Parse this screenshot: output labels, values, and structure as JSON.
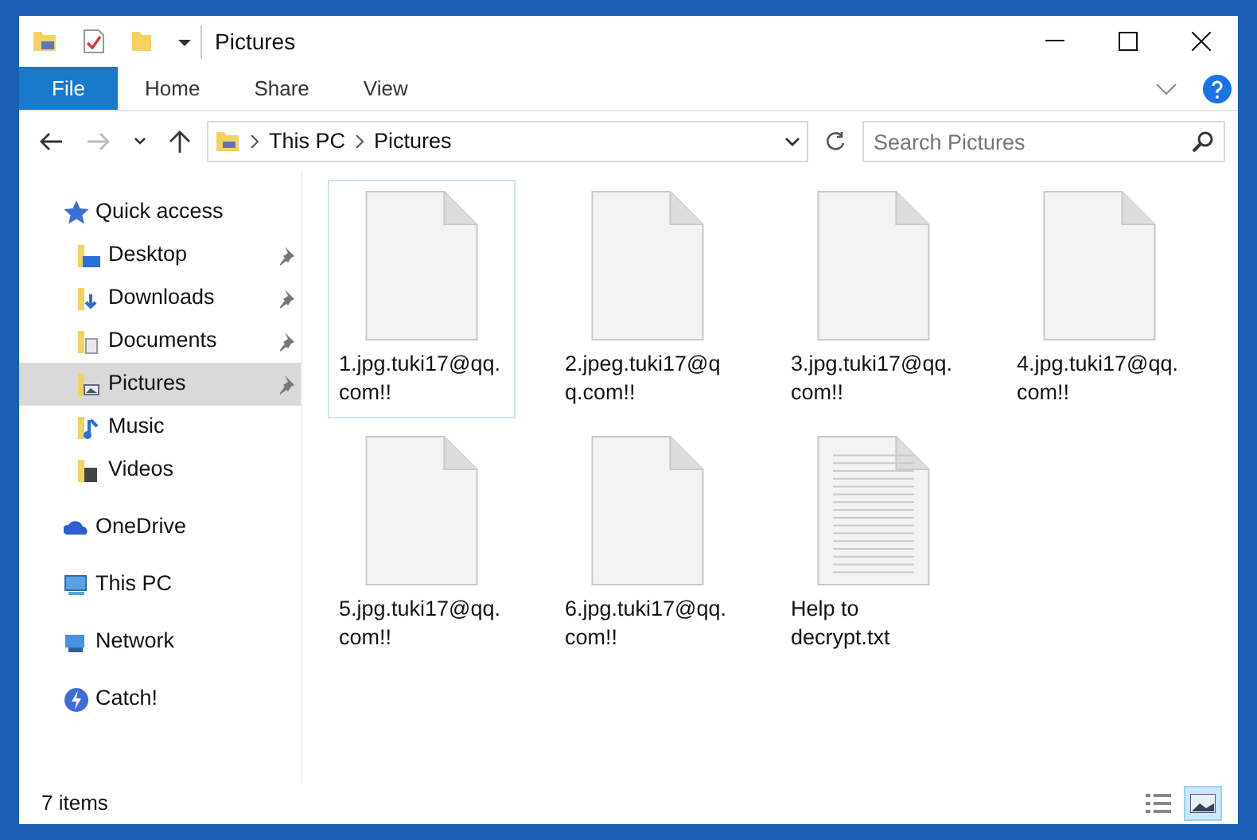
{
  "window": {
    "title": "Pictures"
  },
  "ribbon_tabs": [
    {
      "label": "File",
      "selected": true
    },
    {
      "label": "Home",
      "selected": false
    },
    {
      "label": "Share",
      "selected": false
    },
    {
      "label": "View",
      "selected": false
    }
  ],
  "address_bar": {
    "crumbs": [
      "This PC",
      "Pictures"
    ]
  },
  "search": {
    "placeholder": "Search Pictures"
  },
  "sidebar": {
    "items": [
      {
        "label": "Quick access",
        "kind": "star",
        "selected": false,
        "children": [
          {
            "label": "Desktop",
            "kind": "desktop",
            "pinned": true,
            "selected": false
          },
          {
            "label": "Downloads",
            "kind": "downloads",
            "pinned": true,
            "selected": false
          },
          {
            "label": "Documents",
            "kind": "documents",
            "pinned": true,
            "selected": false
          },
          {
            "label": "Pictures",
            "kind": "pictures",
            "pinned": true,
            "selected": true
          },
          {
            "label": "Music",
            "kind": "music",
            "pinned": false,
            "selected": false
          },
          {
            "label": "Videos",
            "kind": "videos",
            "pinned": false,
            "selected": false
          }
        ]
      },
      {
        "label": "OneDrive",
        "kind": "cloud",
        "selected": false
      },
      {
        "label": "This PC",
        "kind": "pc",
        "selected": false
      },
      {
        "label": "Network",
        "kind": "network",
        "selected": false
      },
      {
        "label": "Catch!",
        "kind": "catch",
        "selected": false
      }
    ]
  },
  "files": [
    {
      "name": "1.jpg.tuki17@qq.com!!",
      "kind": "blank",
      "selected": true
    },
    {
      "name": "2.jpeg.tuki17@qq.com!!",
      "kind": "blank",
      "selected": false
    },
    {
      "name": "3.jpg.tuki17@qq.com!!",
      "kind": "blank",
      "selected": false
    },
    {
      "name": "4.jpg.tuki17@qq.com!!",
      "kind": "blank",
      "selected": false
    },
    {
      "name": "5.jpg.tuki17@qq.com!!",
      "kind": "blank",
      "selected": false
    },
    {
      "name": "6.jpg.tuki17@qq.com!!",
      "kind": "blank",
      "selected": false
    },
    {
      "name": "Help to decrypt.txt",
      "kind": "text",
      "selected": false
    }
  ],
  "status_bar": {
    "count": "7 items"
  },
  "view_buttons": [
    {
      "kind": "details",
      "selected": false
    },
    {
      "kind": "large_icons",
      "selected": true
    }
  ]
}
